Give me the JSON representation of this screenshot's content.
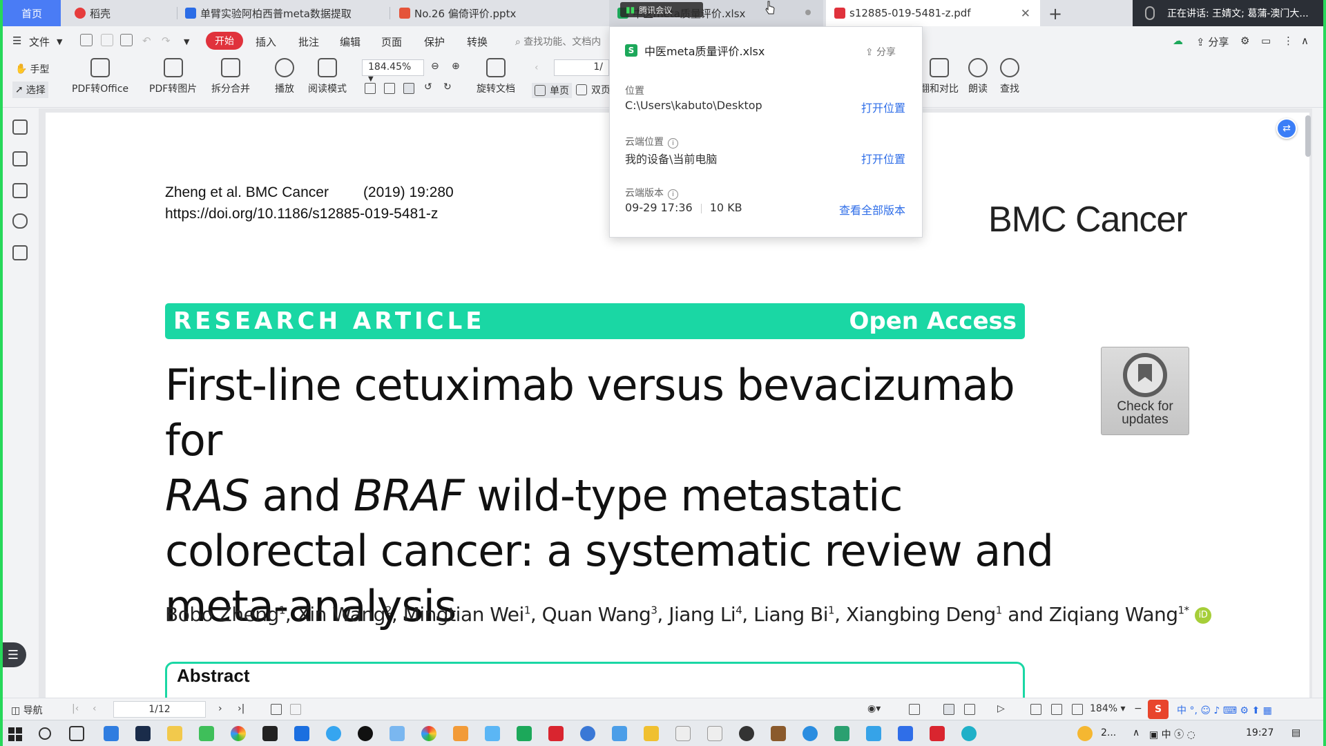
{
  "tabs": [
    {
      "label": "首页",
      "active": false
    },
    {
      "label": "稻壳",
      "icon": "docer-icon"
    },
    {
      "label": "单臂实验阿柏西普meta数据提取",
      "icon": "word-icon"
    },
    {
      "label": "No.26 偏倚评价.pptx",
      "icon": "ppt-icon"
    },
    {
      "label": "中医meta质量评价.xlsx",
      "icon": "excel-icon"
    },
    {
      "label": "s12885-019-5481-z.pdf",
      "icon": "pdf-icon",
      "active": true
    }
  ],
  "meeting": {
    "float_label": "腾讯会议",
    "speaking": "正在讲话: 王婧文; 葛蒲-澳门大..."
  },
  "menu": {
    "file": "文件",
    "start": "开始",
    "items": [
      "插入",
      "批注",
      "编辑",
      "页面",
      "保护",
      "转换"
    ],
    "search_placeholder": "查找功能、文档内",
    "share": "分享"
  },
  "ribbon": {
    "hand": "手型",
    "select": "选择",
    "pdf_to_office": "PDF转Office",
    "pdf_to_image": "PDF转图片",
    "split_merge": "拆分合并",
    "play": "播放",
    "read_mode": "阅读模式",
    "zoom": "184.45%",
    "rotate": "旋转文档",
    "single_page": "单页",
    "double_page": "双页",
    "page_input": "1/",
    "compare": "翻和对比",
    "read_aloud": "朗读",
    "find": "查找"
  },
  "popup": {
    "file_name": "中医meta质量评价.xlsx",
    "share": "分享",
    "location_label": "位置",
    "location_value": "C:\\Users\\kabuto\\Desktop",
    "open_location": "打开位置",
    "cloud_label": "云端位置",
    "cloud_value": "我的设备\\当前电脑",
    "open_location2": "打开位置",
    "version_label": "云端版本",
    "version_time": "09-29 17:36",
    "version_size": "10 KB",
    "all_versions": "查看全部版本"
  },
  "document": {
    "citation_authors": "Zheng et al. BMC Cancer",
    "citation_year": "(2019) 19:280",
    "doi": "https://doi.org/10.1186/s12885-019-5481-z",
    "journal": "BMC Cancer",
    "article_type": "RESEARCH ARTICLE",
    "access": "Open Access",
    "title_line1": "First-line cetuximab versus bevacizumab for",
    "title_line2_a": "RAS",
    "title_line2_b": " and ",
    "title_line2_c": "BRAF",
    "title_line2_d": " wild-type metastatic",
    "title_line3": "colorectal cancer: a systematic review and",
    "title_line4": "meta-analysis",
    "check_updates": "Check for updates",
    "abstract_heading": "Abstract",
    "authors": [
      {
        "name": "Bobo Zheng",
        "sup": "1"
      },
      {
        "name": "Xin Wang",
        "sup": "2"
      },
      {
        "name": "Mingtian Wei",
        "sup": "1"
      },
      {
        "name": "Quan Wang",
        "sup": "3"
      },
      {
        "name": "Jiang Li",
        "sup": "4"
      },
      {
        "name": "Liang Bi",
        "sup": "1"
      },
      {
        "name": "Xiangbing Deng",
        "sup": "1"
      },
      {
        "name": "Ziqiang Wang",
        "sup": "1*"
      }
    ],
    "authors_joiner": "and"
  },
  "statusbar": {
    "nav": "导航",
    "page": "1/12",
    "zoom": "184%"
  },
  "taskbar": {
    "clock": "19:27",
    "weather": "2..."
  },
  "colors": {
    "accent_blue": "#4a7cf5",
    "start_red": "#e0323c",
    "banner_teal": "#1ad7a4",
    "border_green": "#27d85a"
  }
}
